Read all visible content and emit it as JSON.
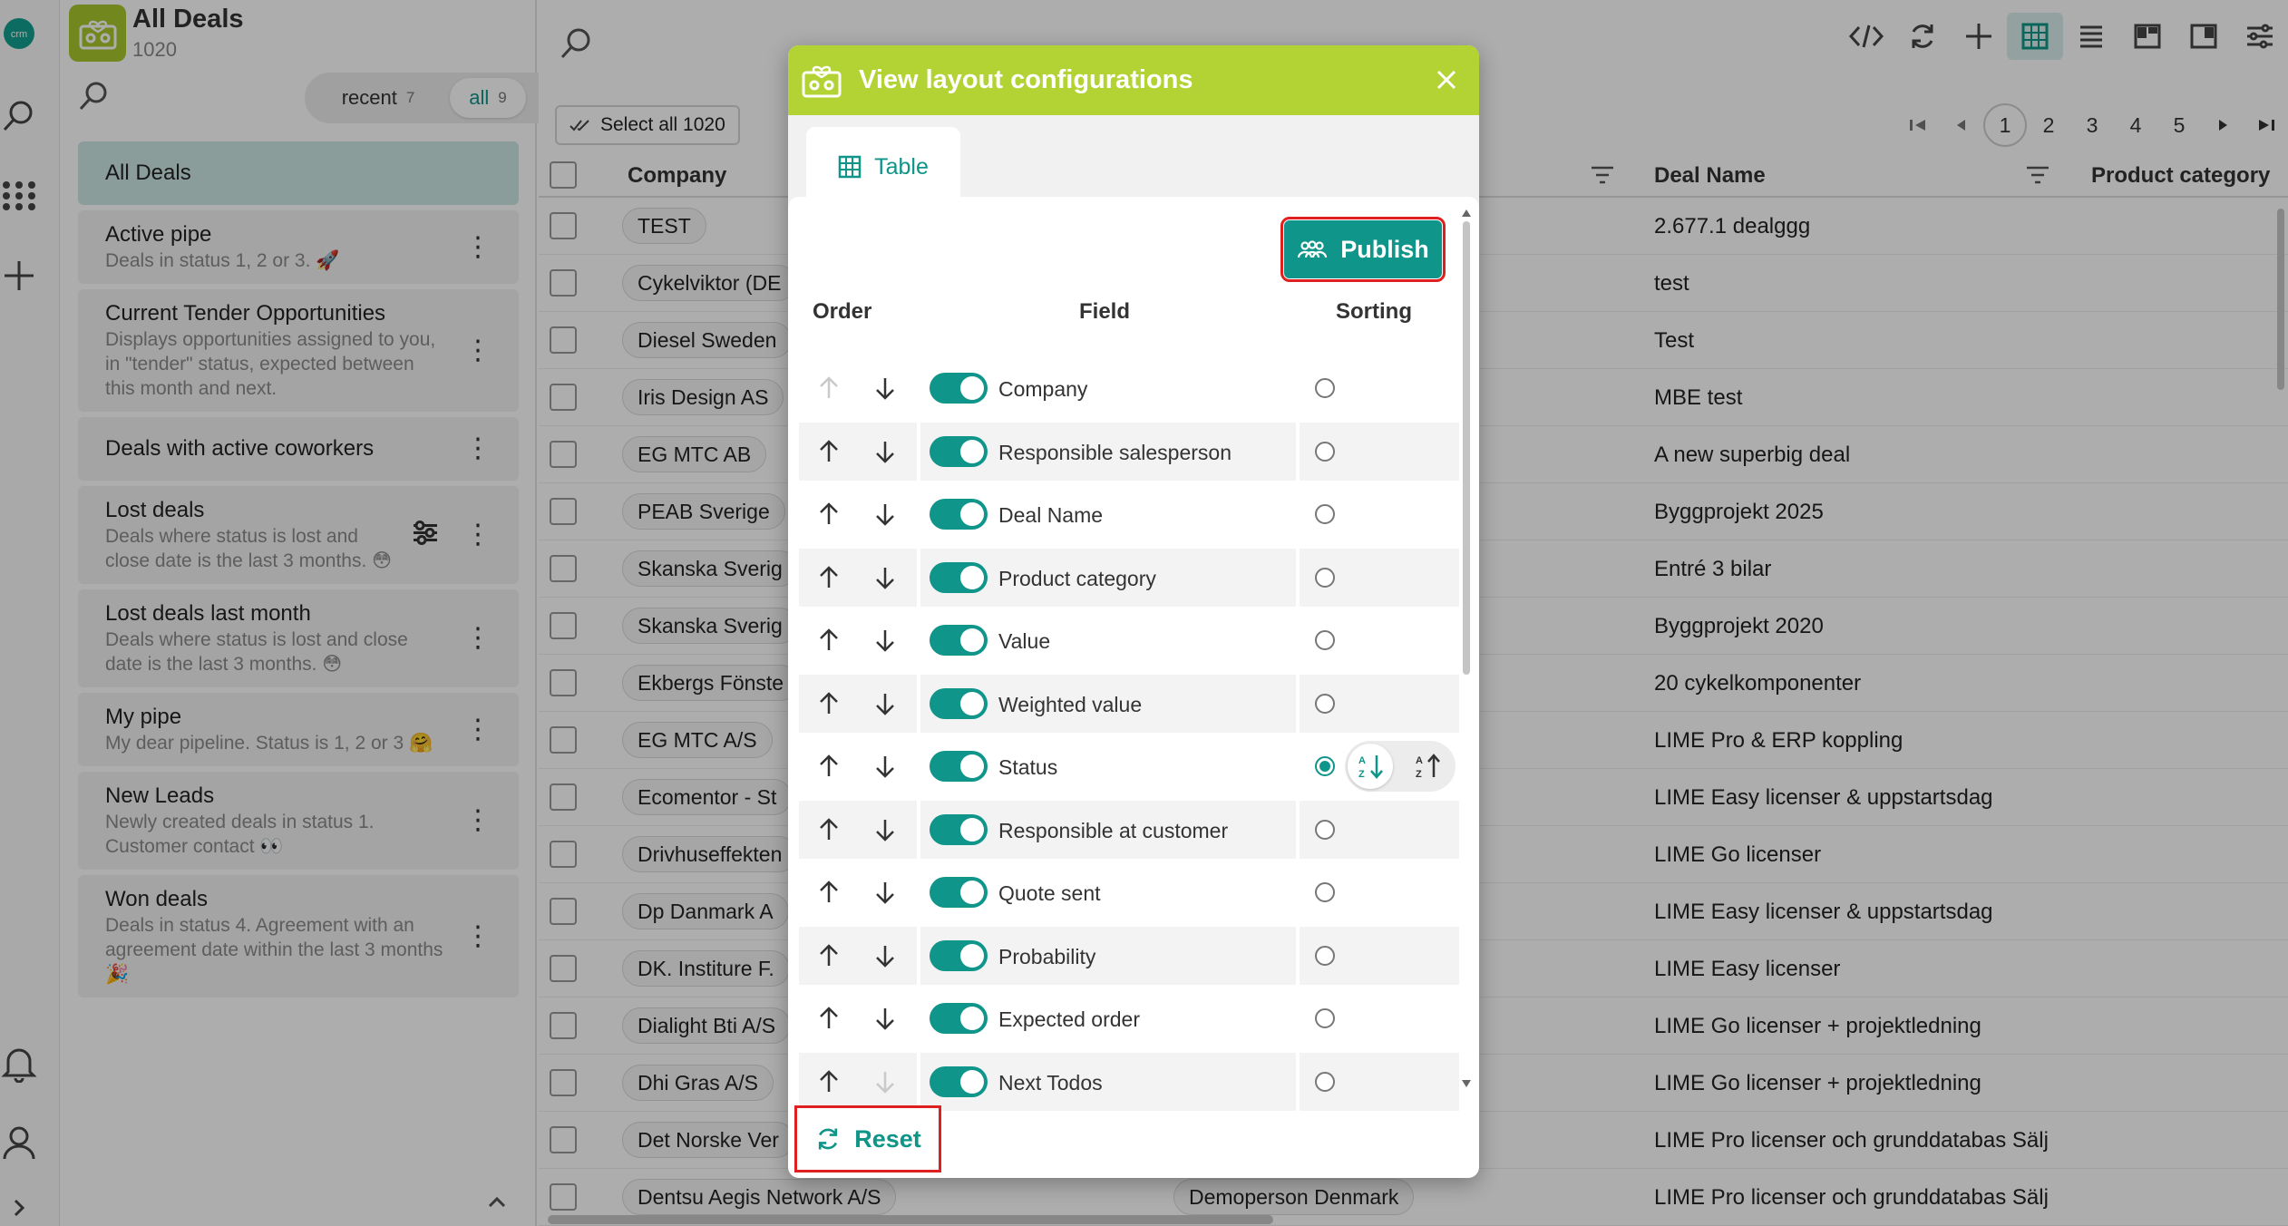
{
  "sidebar": {
    "title": "All Deals",
    "count": "1020",
    "toggle": {
      "recent_label": "recent",
      "recent_count": "7",
      "all_label": "all",
      "all_count": "9"
    },
    "items": [
      {
        "name": "All Deals",
        "desc": ""
      },
      {
        "name": "Active pipe",
        "desc": "Deals in status 1, 2 or 3. 🚀"
      },
      {
        "name": "Current Tender Opportunities",
        "desc": "Displays opportunities assigned to you, in \"tender\" status, expected between this month and next."
      },
      {
        "name": "Deals with active coworkers",
        "desc": ""
      },
      {
        "name": "Lost deals",
        "desc": "Deals where status is lost and close date is the last 3 months. 😳"
      },
      {
        "name": "Lost deals last month",
        "desc": "Deals where status is lost and close date is the last 3 months. 😳"
      },
      {
        "name": "My pipe",
        "desc": "My dear pipeline. Status is 1, 2 or 3 🤗"
      },
      {
        "name": "New Leads",
        "desc": "Newly created deals in status 1. Customer contact 👀"
      },
      {
        "name": "Won deals",
        "desc": "Deals in status 4. Agreement with an agreement date within the last 3 months🎉"
      }
    ]
  },
  "main": {
    "select_all_label": "Select all 1020",
    "pages": [
      "1",
      "2",
      "3",
      "4",
      "5"
    ],
    "columns": {
      "company": "Company",
      "deal_name": "Deal Name",
      "product_category": "Product category"
    },
    "rows": [
      {
        "company": "TEST",
        "deal": "2.677.1 dealggg"
      },
      {
        "company": "Cykelviktor (DE",
        "deal": "test"
      },
      {
        "company": "Diesel Sweden",
        "deal": "Test"
      },
      {
        "company": "Iris Design AS",
        "deal": "MBE test"
      },
      {
        "company": "EG MTC AB",
        "deal": "A new superbig deal"
      },
      {
        "company": "PEAB Sverige",
        "deal": "Byggprojekt 2025"
      },
      {
        "company": "Skanska Sverig",
        "deal": "Entré 3 bilar"
      },
      {
        "company": "Skanska Sverig",
        "deal": "Byggprojekt 2020"
      },
      {
        "company": "Ekbergs Fönste",
        "deal": "20 cykelkomponenter"
      },
      {
        "company": "EG MTC A/S",
        "deal": "LIME Pro & ERP koppling"
      },
      {
        "company": "Ecomentor - St",
        "deal": "LIME Easy licenser & uppstartsdag"
      },
      {
        "company": "Drivhuseffekten",
        "deal": "LIME Go licenser"
      },
      {
        "company": "Dp Danmark A",
        "deal": "LIME Easy licenser & uppstartsdag"
      },
      {
        "company": "DK. Institure F.",
        "deal": "LIME Easy licenser"
      },
      {
        "company": "Dialight Bti A/S",
        "deal": "LIME Go licenser + projektledning"
      },
      {
        "company": "Dhi Gras A/S",
        "deal": "LIME Go licenser + projektledning"
      },
      {
        "company": "Det Norske Ver",
        "deal": "LIME Pro licenser och grunddatabas Sälj"
      },
      {
        "company": "Dentsu Aegis Network A/S",
        "deal": "LIME Pro licenser och grunddatabas Sälj",
        "person": "Demoperson Denmark"
      }
    ]
  },
  "modal": {
    "title": "View layout configurations",
    "tab_label": "Table",
    "publish_label": "Publish",
    "headers": {
      "order": "Order",
      "field": "Field",
      "sorting": "Sorting"
    },
    "fields": [
      {
        "name": "Company",
        "enabled": true,
        "sorted": false
      },
      {
        "name": "Responsible salesperson",
        "enabled": true,
        "sorted": false
      },
      {
        "name": "Deal Name",
        "enabled": true,
        "sorted": false
      },
      {
        "name": "Product category",
        "enabled": true,
        "sorted": false
      },
      {
        "name": "Value",
        "enabled": true,
        "sorted": false
      },
      {
        "name": "Weighted value",
        "enabled": true,
        "sorted": false
      },
      {
        "name": "Status",
        "enabled": true,
        "sorted": true
      },
      {
        "name": "Responsible at customer",
        "enabled": true,
        "sorted": false
      },
      {
        "name": "Quote sent",
        "enabled": true,
        "sorted": false
      },
      {
        "name": "Probability",
        "enabled": true,
        "sorted": false
      },
      {
        "name": "Expected order",
        "enabled": true,
        "sorted": false
      },
      {
        "name": "Next Todos",
        "enabled": true,
        "sorted": false
      }
    ],
    "reset_label": "Reset"
  },
  "colors": {
    "accent": "#10958a",
    "brand": "#b3d334",
    "highlight": "#e02020"
  }
}
